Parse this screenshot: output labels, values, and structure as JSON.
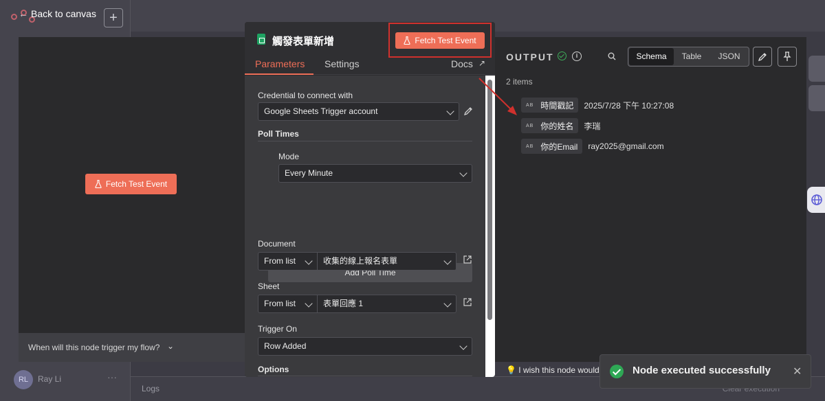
{
  "background": {
    "back_label": "Back to canvas",
    "add_label": "+",
    "user_initials": "RL",
    "user_name": "Ray Li",
    "more_label": "···",
    "logs_label": "Logs",
    "clear_label": "Clear execution"
  },
  "input_panel": {
    "fetch_label": "Fetch Test Event",
    "footer_text": "When will this node trigger my flow?"
  },
  "node": {
    "title": "觸發表單新增",
    "fetch_label": "Fetch Test Event",
    "tabs": [
      "Parameters",
      "Settings"
    ],
    "docs_label": "Docs"
  },
  "params": {
    "credential_label": "Credential to connect with",
    "credential_value": "Google Sheets Trigger account",
    "poll_label": "Poll Times",
    "mode_label": "Mode",
    "mode_value": "Every Minute",
    "add_poll_label": "Add Poll Time",
    "document_label": "Document",
    "document_source": "From list",
    "document_value": "收集的線上報名表單",
    "sheet_label": "Sheet",
    "sheet_source": "From list",
    "sheet_value": "表單回應 1",
    "trigger_label": "Trigger On",
    "trigger_value": "Row Added",
    "options_label": "Options"
  },
  "output": {
    "title": "OUTPUT",
    "views": [
      "Schema",
      "Table",
      "JSON"
    ],
    "active_view": "Schema",
    "items_count": "2 items",
    "fields": [
      {
        "type": "AB",
        "name": "時間戳記",
        "value": "2025/7/28 下午 10:27:08"
      },
      {
        "type": "AB",
        "name": "你的姓名",
        "value": "李瑞"
      },
      {
        "type": "AB",
        "name": "你的Email",
        "value": "ray2025@gmail.com"
      }
    ]
  },
  "hint_text": "I wish this node would",
  "toast": {
    "message": "Node executed successfully",
    "status_color": "#2ea855"
  },
  "colors": {
    "accent": "#ee6e57",
    "annotation": "#d0312d"
  }
}
